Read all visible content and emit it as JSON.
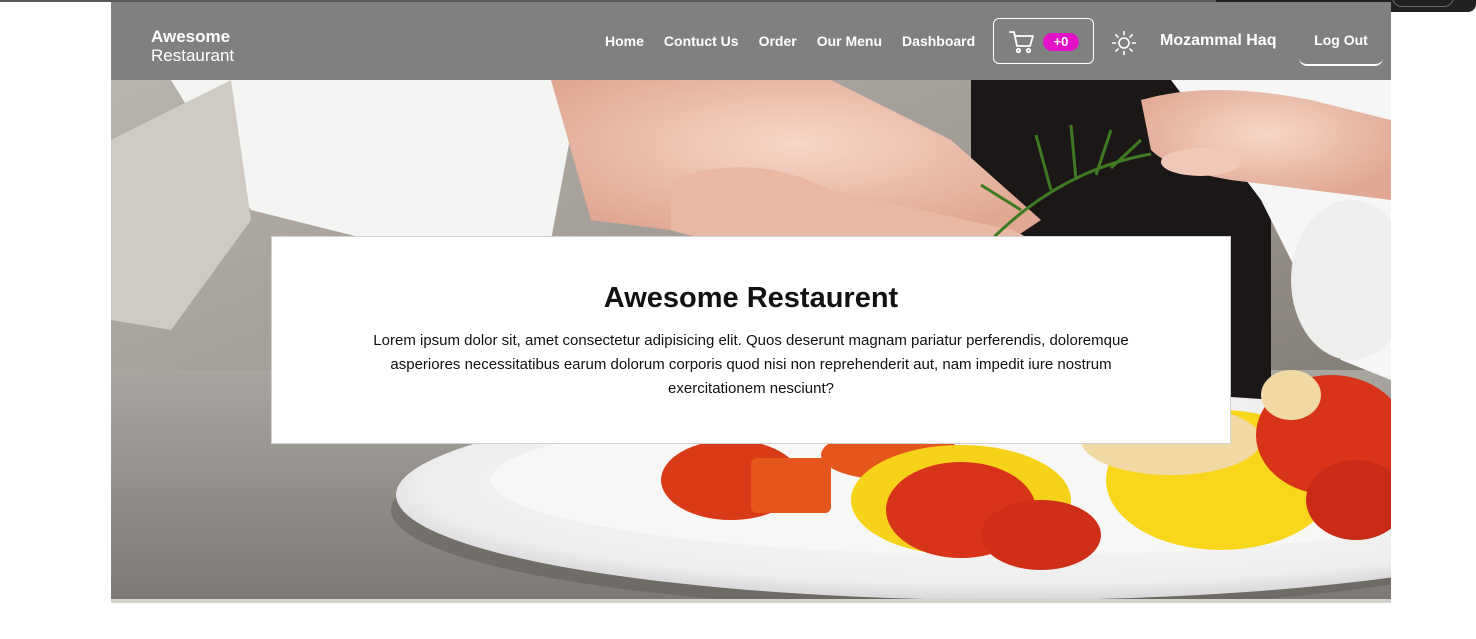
{
  "brand": {
    "line1": "Awesome",
    "line2": "Restaurant"
  },
  "nav": {
    "links": [
      "Home",
      "Contuct Us",
      "Order",
      "Our Menu",
      "Dashboard"
    ],
    "cart": {
      "icon": "cart-icon",
      "count_label": "+0",
      "badge_color": "#e312c9"
    },
    "theme_toggle_icon": "sun-icon",
    "user_name": "Mozammal Haq",
    "logout_label": "Log Out",
    "navbar_color": "#808080"
  },
  "hero": {
    "title": "Awesome Restaurent",
    "text": "Lorem ipsum dolor sit, amet consectetur adipisicing elit. Quos deserunt magnam pariatur perferendis, doloremque asperiores necessitatibus earum dolorum corporis quod nisi non reprehenderit aut, nam impedit iure nostrum exercitationem nesciunt?"
  }
}
